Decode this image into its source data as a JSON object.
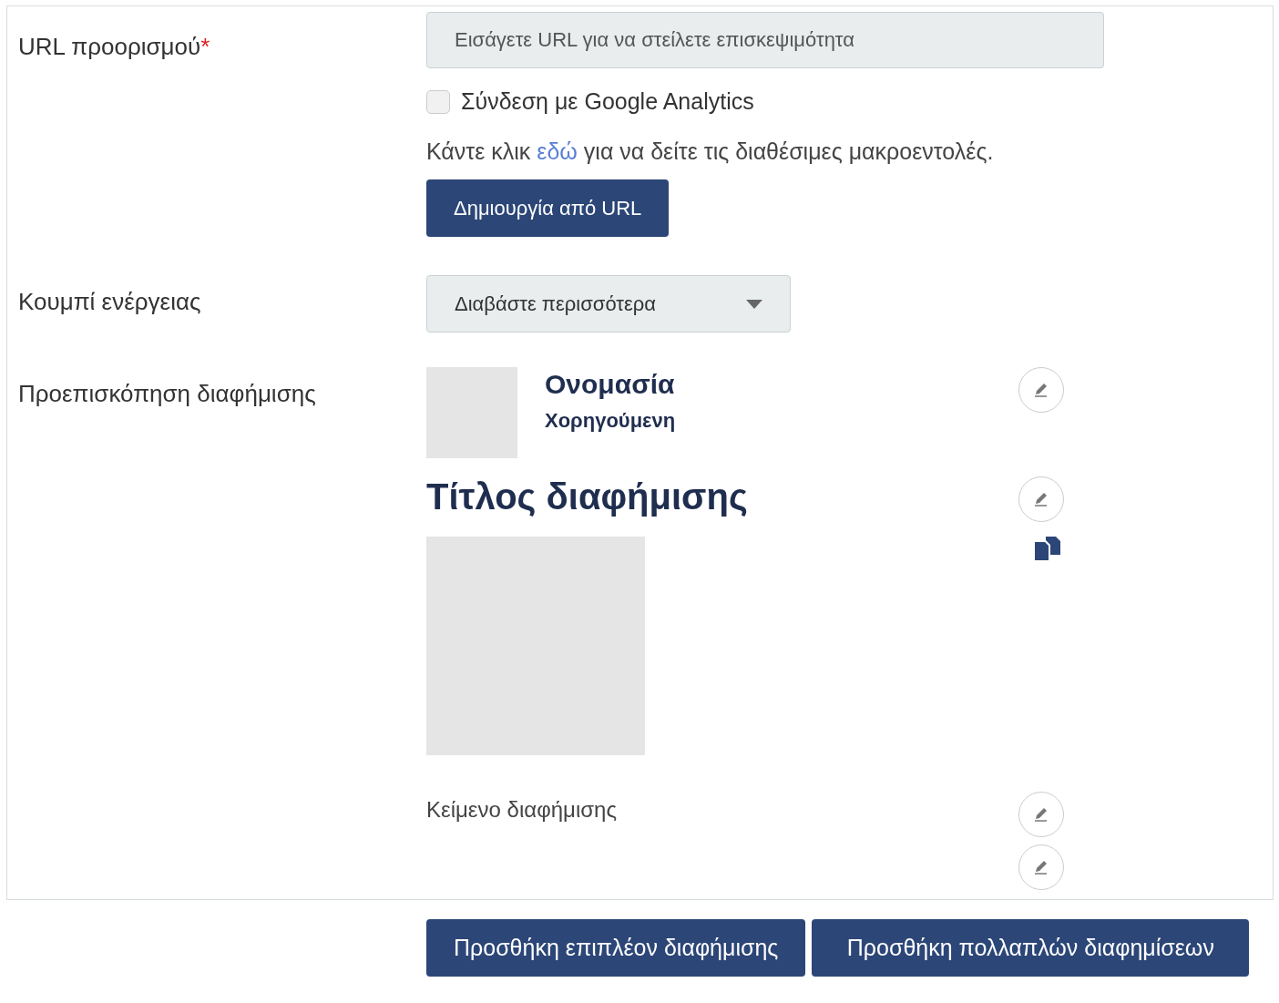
{
  "destination_url": {
    "label": "URL προορισμού",
    "required_mark": "*",
    "placeholder": "Εισάγετε URL για να στείλετε επισκεψιμότητα",
    "analytics": {
      "label": "Σύνδεση με Google Analytics",
      "checked": false
    },
    "help": {
      "before": "Κάντε κλικ ",
      "link": "εδώ",
      "after": " για να δείτε τις διαθέσιμες μακροεντολές."
    },
    "button": "Δημιουργία από URL"
  },
  "action_button": {
    "label": "Κουμπί ενέργειας",
    "value": "Διαβάστε περισσότερα"
  },
  "preview": {
    "label": "Προεπισκόπηση διαφήμισης",
    "name": "Ονομασία",
    "sponsored": "Χορηγούμενη",
    "title": "Τίτλος διαφήμισης",
    "body": "Κείμενο διαφήμισης"
  },
  "footer_buttons": [
    "Προσθήκη επιπλέον διαφήμισης",
    "Προσθήκη πολλαπλών διαφημίσεων"
  ]
}
